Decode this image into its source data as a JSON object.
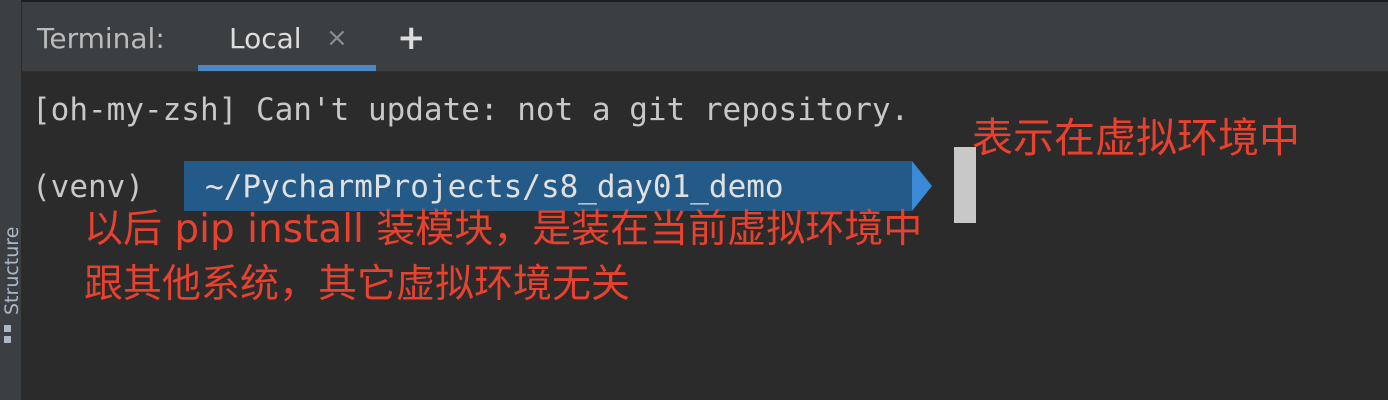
{
  "sidebar": {
    "structure_label": "Structure"
  },
  "terminal": {
    "title": "Terminal:",
    "tabs": [
      {
        "label": "Local",
        "close": "×"
      }
    ],
    "add_tab": "+",
    "output_lines": [
      "[oh-my-zsh] Can't update: not a git repository."
    ],
    "prompt": {
      "venv": "(venv)",
      "path": "~/PycharmProjects/s8_day01_demo"
    }
  },
  "annotations": {
    "a1": "表示在虚拟环境中",
    "a2": "以后 pip install 装模块，是装在当前虚拟环境中",
    "a3": "跟其他系统，其它虚拟环境无关"
  },
  "colors": {
    "background": "#2b2b2b",
    "tab_underline": "#4a88c7",
    "path_segment": "#235a88",
    "annotation": "#e8412e"
  }
}
